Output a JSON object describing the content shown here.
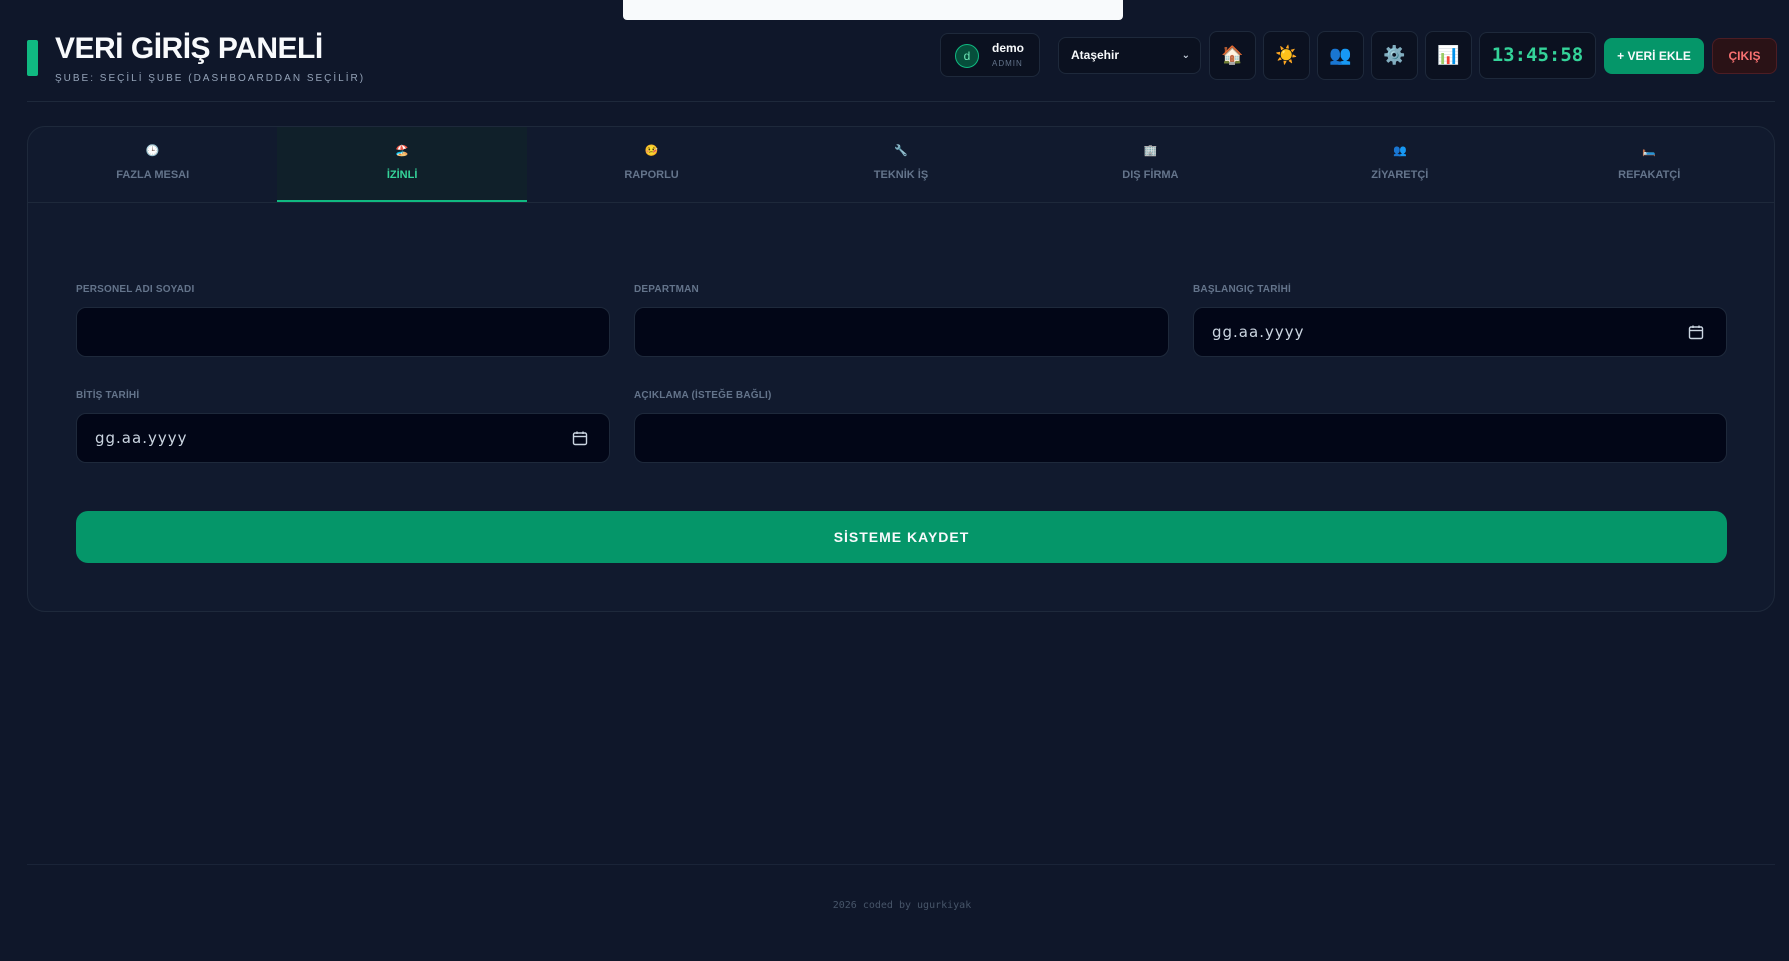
{
  "header": {
    "title": "VERİ GİRİŞ PANELİ",
    "subtitle": "ŞUBE: SEÇİLİ ŞUBE (DASHBOARDDAN SEÇİLİR)",
    "user": {
      "initial": "d",
      "name": "demo",
      "role": "ADMIN"
    },
    "branch": {
      "selected": "Ataşehir"
    },
    "icons": [
      "home-icon",
      "sun-icon",
      "users-icon",
      "gear-icon",
      "chart-icon"
    ],
    "clock": "13:45:58",
    "add_label": "+ VERİ EKLE",
    "logout_label": "ÇIKIŞ"
  },
  "tabs": [
    {
      "label": "FAZLA MESAI",
      "icon": "🕒",
      "icon_name": "clock-icon",
      "active": false
    },
    {
      "label": "İZİNLİ",
      "icon": "🏖️",
      "icon_name": "beach-icon",
      "active": true
    },
    {
      "label": "RAPORLU",
      "icon": "🤒",
      "icon_name": "sick-face-icon",
      "active": false
    },
    {
      "label": "TEKNİK İŞ",
      "icon": "🔧",
      "icon_name": "wrench-icon",
      "active": false
    },
    {
      "label": "DIŞ FİRMA",
      "icon": "🏢",
      "icon_name": "office-building-icon",
      "active": false
    },
    {
      "label": "ZİYARETÇİ",
      "icon": "👥",
      "icon_name": "visitors-icon",
      "active": false
    },
    {
      "label": "REFAKATÇİ",
      "icon": "🛏️",
      "icon_name": "bed-icon",
      "active": false
    }
  ],
  "form": {
    "personnel_label": "PERSONEL ADI SOYADI",
    "personnel_value": "",
    "department_label": "DEPARTMAN",
    "department_value": "",
    "start_label": "BAŞLANGIÇ TARİHİ",
    "start_placeholder": "gg.aa.yyyy",
    "end_label": "BİTİŞ TARİHİ",
    "end_placeholder": "gg.aa.yyyy",
    "note_label": "AÇIKLAMA (İSTEĞE BAĞLI)",
    "note_value": "",
    "submit_label": "SİSTEME KAYDET"
  },
  "footer": {
    "text": "2026 coded by ugurkiyak"
  },
  "colors": {
    "accent": "#10b981",
    "accent_dark": "#059669",
    "background": "#0f172a",
    "danger": "#f87171"
  }
}
